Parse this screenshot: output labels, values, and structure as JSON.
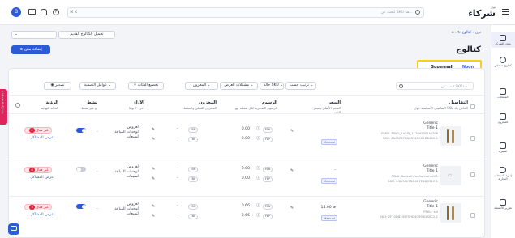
{
  "brand": {
    "name": "شركاء",
    "sub": "نون"
  },
  "search": {
    "placeholder": "ابحث عن SKU هنا...",
    "shortcut": "⌘ K"
  },
  "user": {
    "initial": "B"
  },
  "breadcrumb": {
    "root": "نون",
    "current": "كتالوج"
  },
  "page": {
    "title": "كتالوج"
  },
  "channels": {
    "noon": "Noon",
    "supermall": "Supermall"
  },
  "actions": {
    "add_product": "إضافة منتج",
    "download_old_catalog": "تحميل الكتالوج القديم"
  },
  "sidebar": {
    "items": [
      {
        "label": "متجر الشركة",
        "icon": "store-icon"
      },
      {
        "label": "كتالوج منتجاتي",
        "icon": "catalog-icon"
      },
      {
        "label": "المنتجات",
        "icon": "products-icon"
      },
      {
        "label": "المخزون",
        "icon": "inventory-icon"
      },
      {
        "label": "استيراد",
        "icon": "import-icon"
      },
      {
        "label": "إدارة المنتجات التجارية",
        "icon": "tag-icon"
      },
      {
        "label": "تقارير الأنشطة",
        "icon": "reports-icon"
      }
    ]
  },
  "feedback_tab": {
    "label": "مشاركة الملاحظات"
  },
  "filters": {
    "search_placeholder": "ابحث عن SKU هنا...",
    "sort": "ترتيب حسب",
    "status": "حالة SKU",
    "issues": "مشكلات العرض",
    "inventory": "المخزون",
    "price_fix": "تخضيع الفئات",
    "more_filters": "عوامل التصفية",
    "export": "تصدير"
  },
  "table": {
    "headers": {
      "details": {
        "title": "التفاصيل",
        "sub": "التفاصيل الأساسية حول SKU الخاص بك"
      },
      "price": {
        "title": "السعر",
        "sub": "السعر الأصلي وسعر الخصم"
      },
      "fees": {
        "title": "الرسوم",
        "sub": "الرسوم التقديرية لكل عملية بيع"
      },
      "inventory": {
        "title": "المخزون",
        "sub": "المخزون الفعلي والنشط"
      },
      "performance": {
        "title": "الأداء",
        "sub": "آخر ٣٠ يومًا"
      },
      "active": {
        "title": "نشط",
        "sub": "أو غير نشط"
      },
      "visibility": {
        "title": "الرؤية",
        "sub": "الحالة النهائية"
      }
    },
    "rows": [
      {
        "name": "Generic",
        "title": "Title 1",
        "psku": "PSKU: PSKU_1a3f5_1178d20S1t8708",
        "sku": "SKU: 2A00F678D09322002D6480-1",
        "price": "-",
        "price_mode": "Manual",
        "fee_a": "0.00",
        "fee_b": "0.00",
        "fee_chip_a": "FBN",
        "fee_chip_b": "FBP",
        "inv_a": "-",
        "inv_b": "-",
        "inv_chip_a": "FBN",
        "inv_chip_b": "FBP",
        "perf_a": "العروض",
        "perf_b": "الوحدات المباعة",
        "perf_c": "المبيعات",
        "perf_val": "-",
        "active": true,
        "visibility": "غير فعال",
        "issues_count": "2",
        "issues_link": "عرض المشاكل"
      },
      {
        "name": "Generic",
        "title": "Title 1",
        "psku": "PSKU: Ibalcalhyealnginohinl01",
        "sku": "SKU: 23D7A07BD4B7E4D9313-1",
        "price": "-",
        "price_mode": "Manual",
        "fee_a": "0.00",
        "fee_b": "0.00",
        "fee_chip_a": "FBN",
        "fee_chip_b": "FBP",
        "inv_a": "-",
        "inv_b": "-",
        "inv_chip_a": "FBN",
        "inv_chip_b": "FBP",
        "perf_a": "العروض",
        "perf_b": "الوحدات المباعة",
        "perf_c": "المبيعات",
        "perf_val": "-",
        "active": false,
        "visibility": "غير فعال",
        "issues_count": "6",
        "issues_link": "عرض المشاكل"
      },
      {
        "name": "Generic",
        "title": "Title 1",
        "psku": "PSKU: sel",
        "sku": "SKU: 2F10D8249F5HD4C998DB0C2-1",
        "price": "14.00 ⊕",
        "price_mode": "Manual",
        "fee_a": "0.66",
        "fee_b": "0.66",
        "fee_chip_a": "FBN",
        "fee_chip_b": "FBP",
        "inv_a": "-",
        "inv_b": "-",
        "inv_chip_a": "FBN",
        "inv_chip_b": "FBP",
        "perf_a": "العروض",
        "perf_b": "الوحدات المباعة",
        "perf_c": "المبيعات",
        "perf_val": "-",
        "active": true,
        "visibility": "غير فعال",
        "issues_count": "3",
        "issues_link": "عرض المشاكل"
      }
    ]
  },
  "colors": {
    "accent": "#2b5bd7",
    "danger": "#e0243f",
    "highlight": "#f5d21a"
  }
}
